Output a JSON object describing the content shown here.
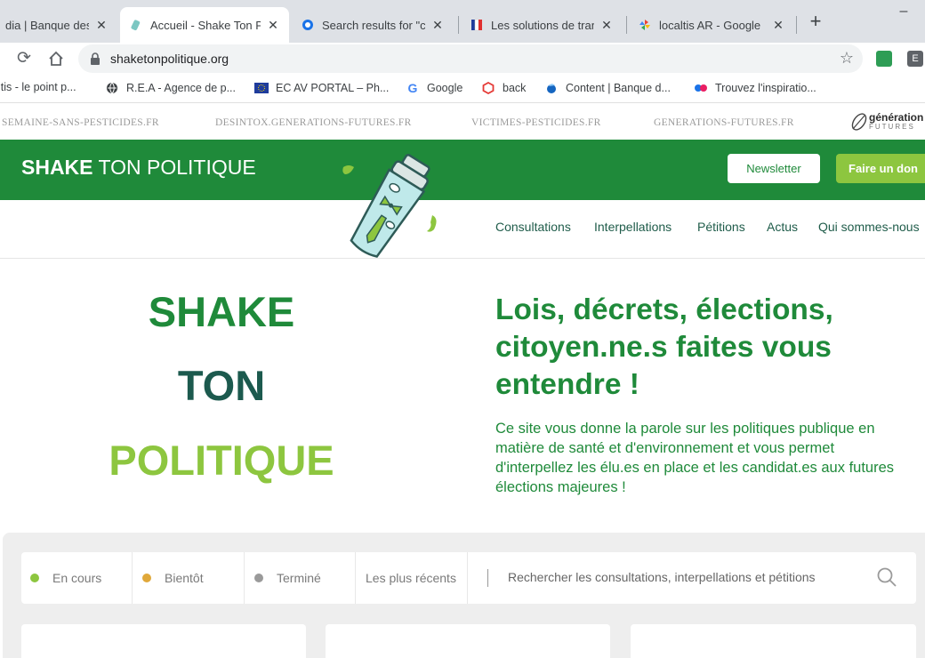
{
  "browser": {
    "tabs": [
      {
        "title": "dia | Banque des ",
        "icon": "page-icon"
      },
      {
        "title": "Accueil - Shake Ton P",
        "icon": "shaker-favicon"
      },
      {
        "title": "Search results for \"cc",
        "icon": "search-favicon"
      },
      {
        "title": "Les solutions de tran",
        "icon": "flag-favicon"
      },
      {
        "title": "localtis AR - Google ",
        "icon": "pinwheel-favicon"
      }
    ],
    "new_tab": "+",
    "minimize": "–",
    "url": "shaketonpolitique.org",
    "bookmarks": [
      {
        "label": "ltis - le point p...",
        "icon": "bookmark-icon"
      },
      {
        "label": "R.E.A - Agence de p...",
        "icon": "globe-icon"
      },
      {
        "label": "EC AV PORTAL – Ph...",
        "icon": "eu-flag-icon"
      },
      {
        "label": "Google",
        "icon": "google-icon"
      },
      {
        "label": "back",
        "icon": "hexagon-icon"
      },
      {
        "label": "Content | Banque d...",
        "icon": "drop-icon"
      },
      {
        "label": "Trouvez l'inspiratio...",
        "icon": "dots-icon"
      }
    ]
  },
  "partners": {
    "links": [
      "SEMAINE-SANS-PESTICIDES.FR",
      "DESINTOX.GENERATIONS-FUTURES.FR",
      "VICTIMES-PESTICIDES.FR",
      "GENERATIONS-FUTURES.FR"
    ],
    "logo_text": "génération",
    "logo_sub": "FUTURES"
  },
  "header": {
    "brand_bold": "SHAKE",
    "brand_rest": " TON POLITIQUE",
    "newsletter": "Newsletter",
    "donate": "Faire un don"
  },
  "nav": [
    "Consultations",
    "Interpellations",
    "Pétitions",
    "Actus",
    "Qui sommes-nous"
  ],
  "hero": {
    "word1": "SHAKE",
    "word2": "TON",
    "word3": "POLITIQUE",
    "headline": "Lois, décrets, élections, citoyen.ne.s faites vous entendre !",
    "intro": "Ce site vous donne la parole sur les politiques publique en matière de santé et d'environnement et vous permet d'interpellez les élu.es en place et les candidat.es aux futures élections majeures !"
  },
  "filters": {
    "items": [
      {
        "label": "En cours",
        "color": "#8dc63f"
      },
      {
        "label": "Bientôt",
        "color": "#e0a83a"
      },
      {
        "label": "Terminé",
        "color": "#9a9a9a"
      }
    ],
    "recent": "Les plus récents",
    "search_placeholder": "Rechercher les consultations, interpellations et pétitions"
  },
  "colors": {
    "brand_green": "#1f8a3a",
    "light_green": "#8dc63f",
    "dark_teal": "#1c5a4e"
  }
}
